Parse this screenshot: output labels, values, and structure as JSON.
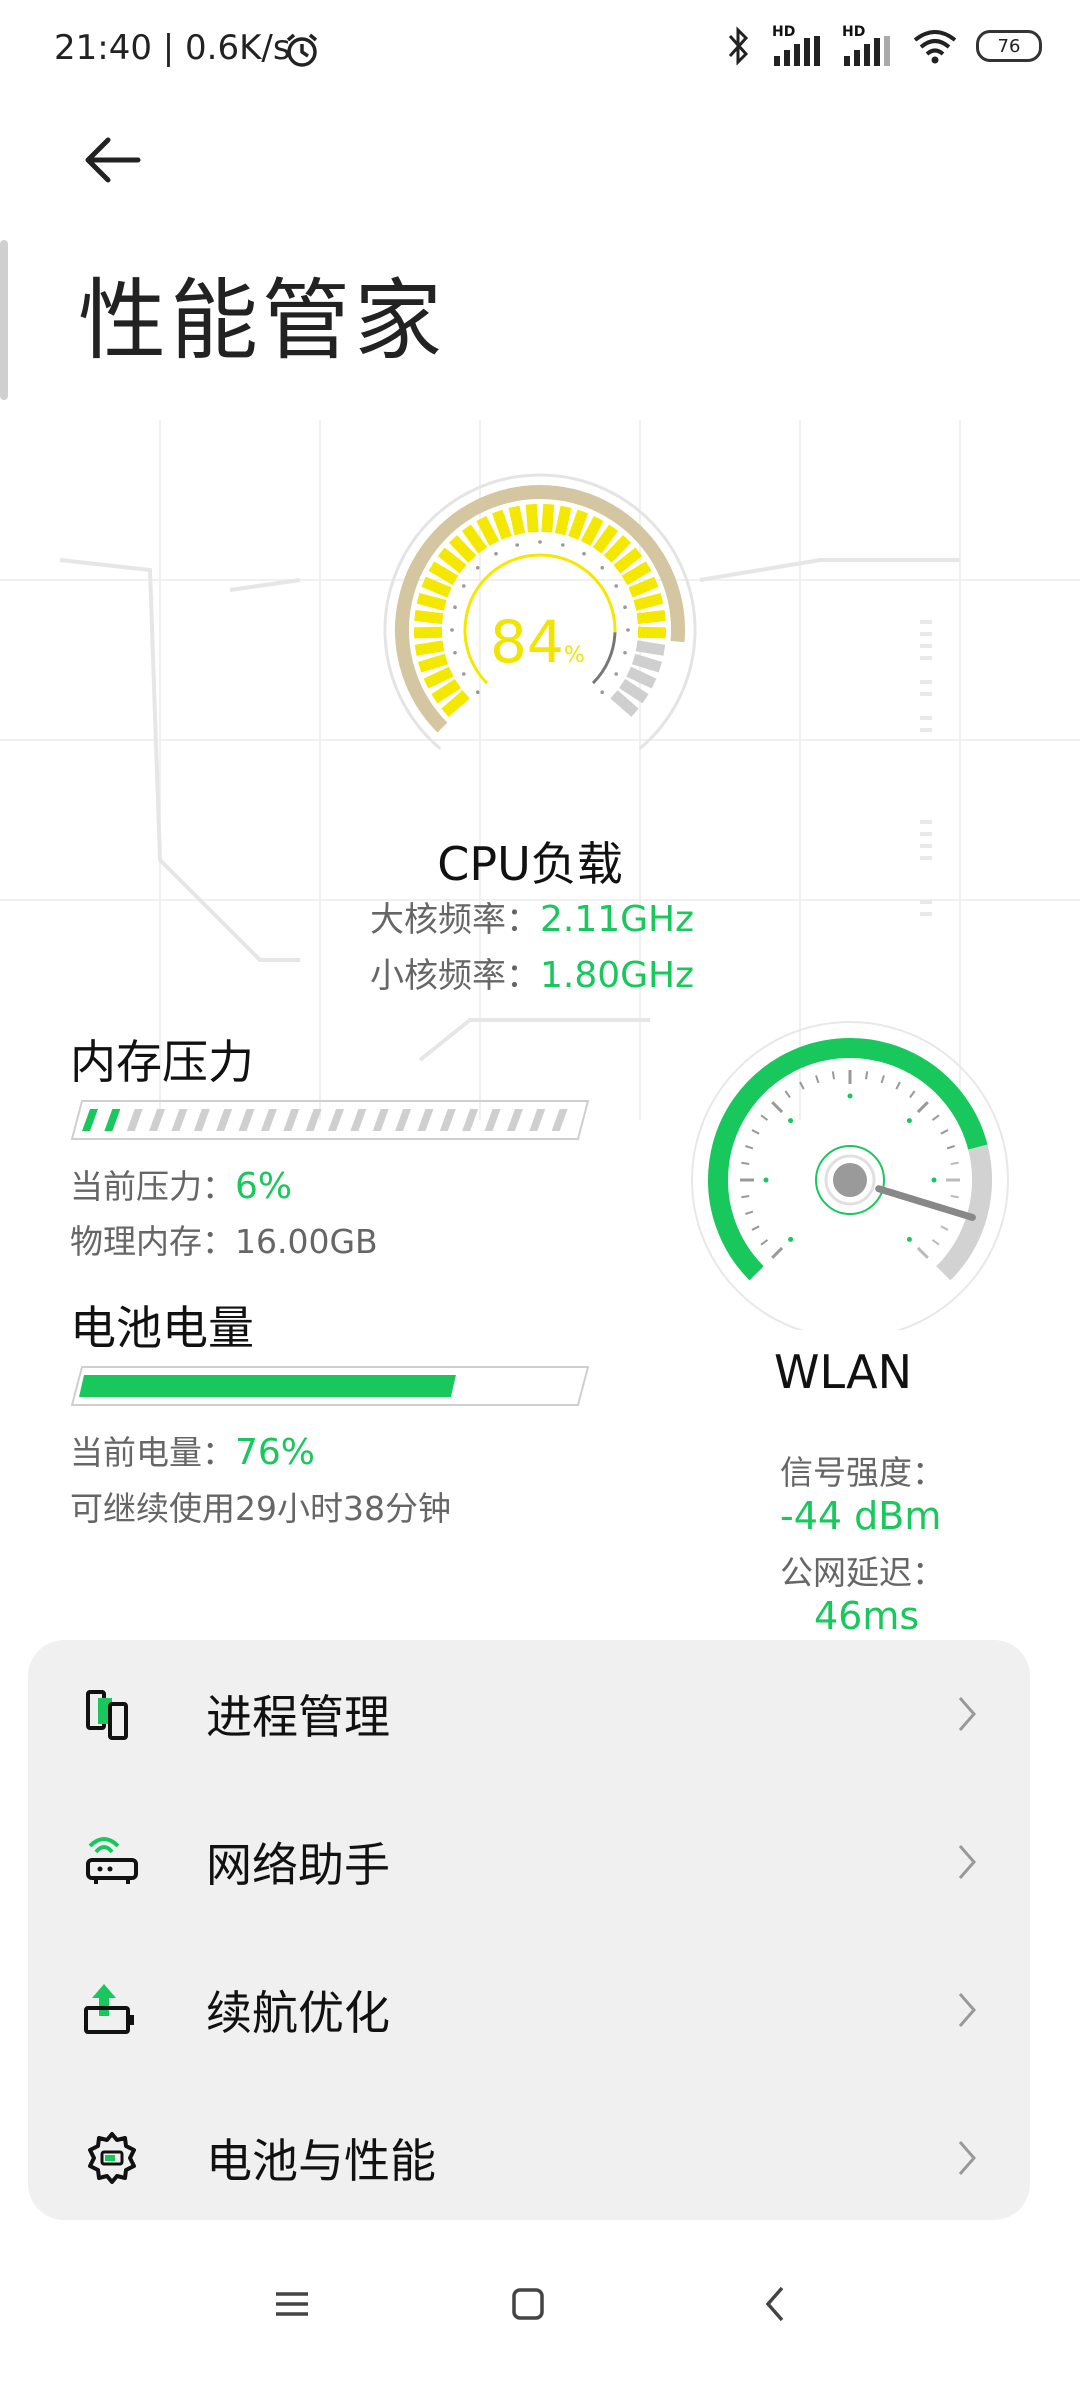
{
  "status_bar": {
    "time_speed": "21:40 | 0.6K/s",
    "signal1": "HD",
    "signal2": "HD",
    "battery": "76"
  },
  "header": {
    "title": "性能管家"
  },
  "cpu": {
    "value": "84",
    "unit": "%",
    "title": "CPU负载",
    "big_core_label": "大核频率：",
    "big_core_value": "2.11GHz",
    "small_core_label": "小核频率：",
    "small_core_value": "1.80GHz",
    "load_percent": 84
  },
  "memory": {
    "title": "内存压力",
    "pressure_label": "当前压力：",
    "pressure_value": "6%",
    "physical_label": "物理内存：",
    "physical_value": "16.00GB",
    "pressure_fraction": 0.06
  },
  "battery": {
    "title": "电池电量",
    "level_label": "当前电量：",
    "level_value": "76%",
    "remaining": "可继续使用29小时38分钟",
    "level_fraction": 0.76
  },
  "wlan": {
    "title": "WLAN",
    "signal_label": "信号强度：",
    "signal_value": "-44 dBm",
    "latency_label": "公网延迟：",
    "latency_value": "46ms"
  },
  "menu": {
    "items": [
      {
        "label": "进程管理",
        "icon": "process-icon"
      },
      {
        "label": "网络助手",
        "icon": "router-icon"
      },
      {
        "label": "续航优化",
        "icon": "battery-boost-icon"
      },
      {
        "label": "电池与性能",
        "icon": "gear-battery-icon"
      }
    ]
  },
  "colors": {
    "accent_green": "#19c85c",
    "cpu_yellow": "#f5e800",
    "cpu_ring": "#d4c6a0"
  }
}
